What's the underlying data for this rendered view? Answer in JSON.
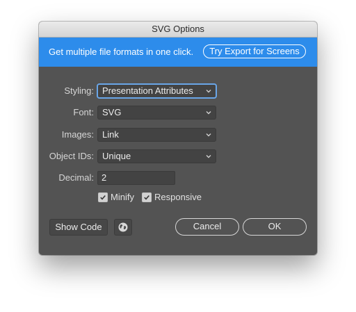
{
  "window": {
    "title": "SVG Options"
  },
  "banner": {
    "text": "Get multiple file formats in one click.",
    "button_label": "Try Export for Screens",
    "color": "#2d8ceb"
  },
  "form": {
    "styling": {
      "label": "Styling:",
      "value": "Presentation Attributes"
    },
    "font": {
      "label": "Font:",
      "value": "SVG"
    },
    "images": {
      "label": "Images:",
      "value": "Link"
    },
    "object_ids": {
      "label": "Object IDs:",
      "value": "Unique"
    },
    "decimal": {
      "label": "Decimal:",
      "value": "2"
    },
    "minify": {
      "label": "Minify",
      "checked": true
    },
    "responsive": {
      "label": "Responsive",
      "checked": true
    }
  },
  "footer": {
    "show_code_label": "Show Code",
    "globe_icon": "globe-icon",
    "cancel_label": "Cancel",
    "ok_label": "OK"
  }
}
